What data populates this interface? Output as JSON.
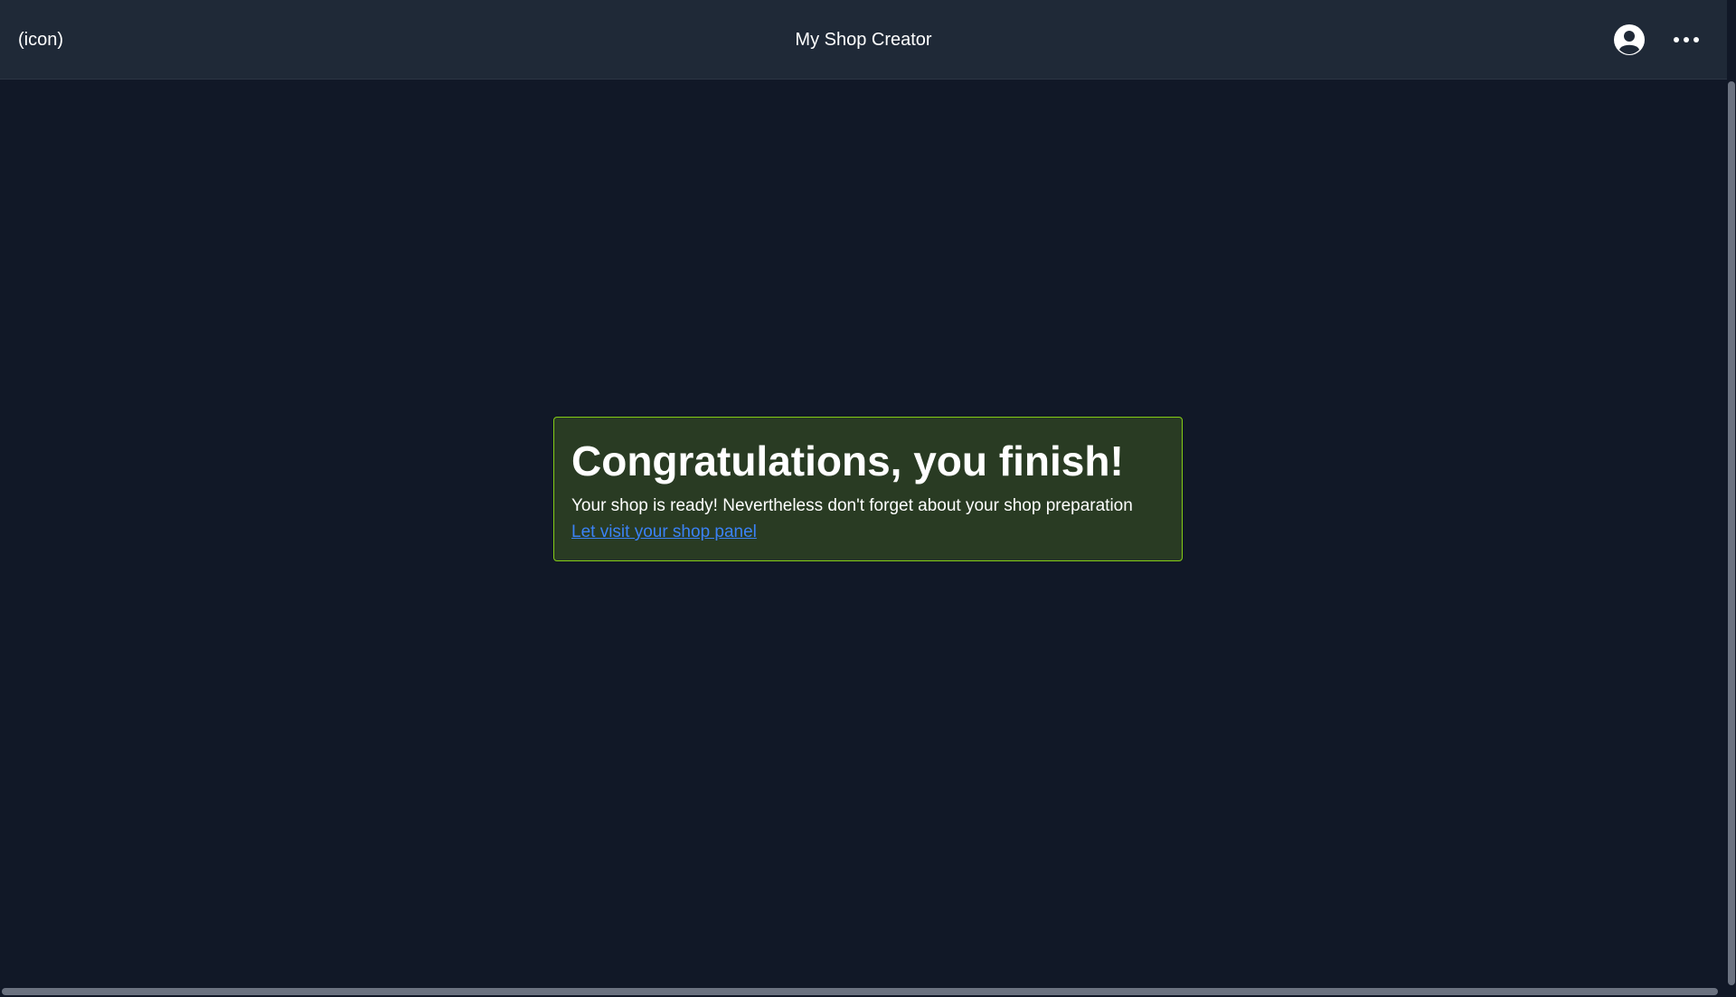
{
  "header": {
    "logo_placeholder": "(icon)",
    "title": "My Shop Creator",
    "user_icon": "user-circle-icon",
    "more_icon": "more-horizontal-icon"
  },
  "alert": {
    "title": "Congratulations, you finish!",
    "message": "Your shop is ready! Nevertheless don't forget about your shop preparation",
    "link_label": "Let visit your shop panel"
  },
  "colors": {
    "header_bg": "#1f2937",
    "page_bg": "#111827",
    "alert_bg": "#293b23",
    "alert_border": "#84cc16",
    "link": "#3b82f6"
  }
}
